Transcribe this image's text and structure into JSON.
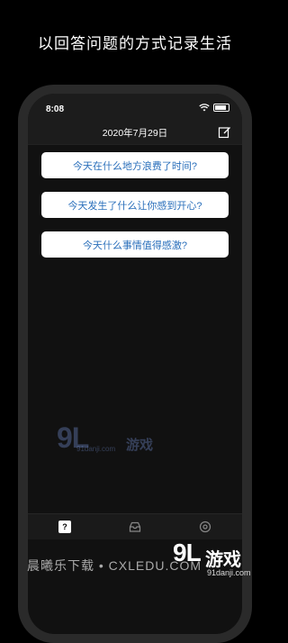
{
  "headline": "以回答问题的方式记录生活",
  "status_bar": {
    "time": "8:08"
  },
  "nav": {
    "title": "2020年7月29日",
    "edit_icon": "compose-icon"
  },
  "questions": [
    "今天在什么地方浪费了时间?",
    "今天发生了什么让你感到开心?",
    "今天什么事情值得感激?"
  ],
  "tabbar": {
    "tabs": [
      {
        "icon": "question-icon",
        "label": "?"
      },
      {
        "icon": "inbox-icon"
      },
      {
        "icon": "settings-icon"
      }
    ]
  },
  "watermark": {
    "logo": "9L",
    "name": "游戏",
    "url": "91danji.com"
  },
  "footer": {
    "text": "晨曦乐下载 • CXLEDU.COM"
  },
  "corner_brand": {
    "logo": "9L",
    "name": "游戏",
    "url": "91danji.com"
  },
  "colors": {
    "accent": "#2a6fbb",
    "background": "#111111",
    "bar": "#1c1c1c"
  }
}
